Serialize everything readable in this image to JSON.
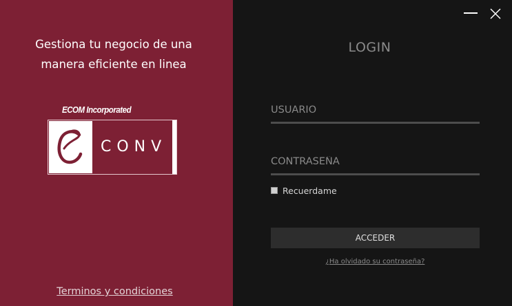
{
  "branding": {
    "slogan_line1": "Gestiona tu negocio de una",
    "slogan_line2": "manera eficiente en linea",
    "company_name": "ECOM Incorporated",
    "logo_text": "CONV",
    "logo_letter": "e",
    "terms_link": "Terminos y condiciones"
  },
  "login": {
    "title": "LOGIN",
    "username_placeholder": "USUARIO",
    "password_placeholder": "CONTRASEÑA",
    "remember_label": "Recuerdame",
    "remember_checked": false,
    "submit_label": "ACCEDER",
    "forgot_link": "¿Ha olvidado su contraseña?"
  },
  "window_controls": {
    "minimize_icon": "minimize-icon",
    "close_icon": "close-icon"
  },
  "colors": {
    "brand_primary": "#7d2034",
    "panel_dark": "#151515",
    "input_underline": "#4d4d4d",
    "button_bg": "#2d2d2d"
  }
}
